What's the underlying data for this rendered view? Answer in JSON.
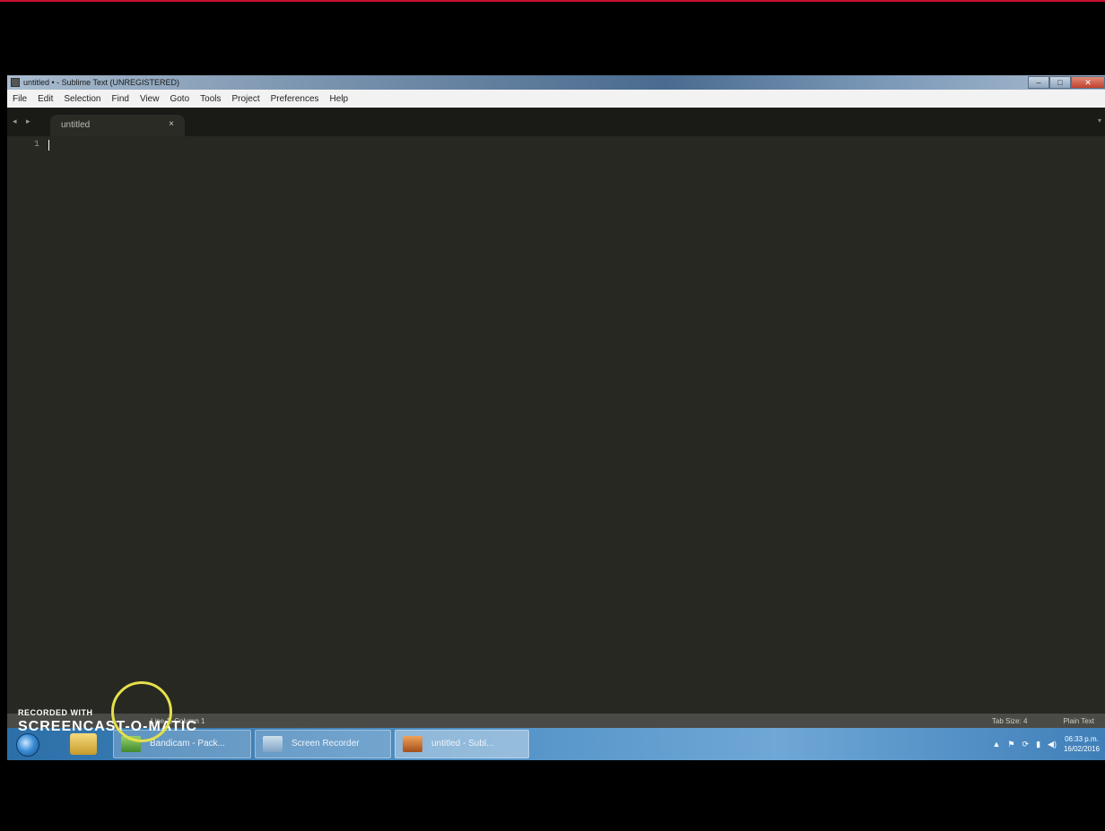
{
  "window": {
    "title": "untitled • - Sublime Text (UNREGISTERED)",
    "controls": {
      "minimize": "–",
      "maximize": "□",
      "close": "✕"
    }
  },
  "menu": [
    "File",
    "Edit",
    "Selection",
    "Find",
    "View",
    "Goto",
    "Tools",
    "Project",
    "Preferences",
    "Help"
  ],
  "tabbar": {
    "nav": "◂ ▸",
    "tab_label": "untitled",
    "tab_close": "×",
    "dropdown": "▾"
  },
  "editor": {
    "line_number": "1",
    "content": ""
  },
  "statusbar": {
    "position": "Line 1, Column 1",
    "tab_size": "Tab Size: 4",
    "syntax": "Plain Text"
  },
  "taskbar": {
    "buttons": [
      {
        "label": "Bandicam - Pack..."
      },
      {
        "label": "Screen Recorder"
      },
      {
        "label": "untitled - Subl..."
      }
    ],
    "clock": {
      "time": "06:33 p.m.",
      "date": "16/02/2016"
    },
    "tray_icons": [
      "▲",
      "⚑",
      "⟳",
      "▮",
      "◀)"
    ]
  },
  "watermark": {
    "line1": "RECORDED WITH",
    "line2": "SCREENCAST-O-MATIC"
  }
}
